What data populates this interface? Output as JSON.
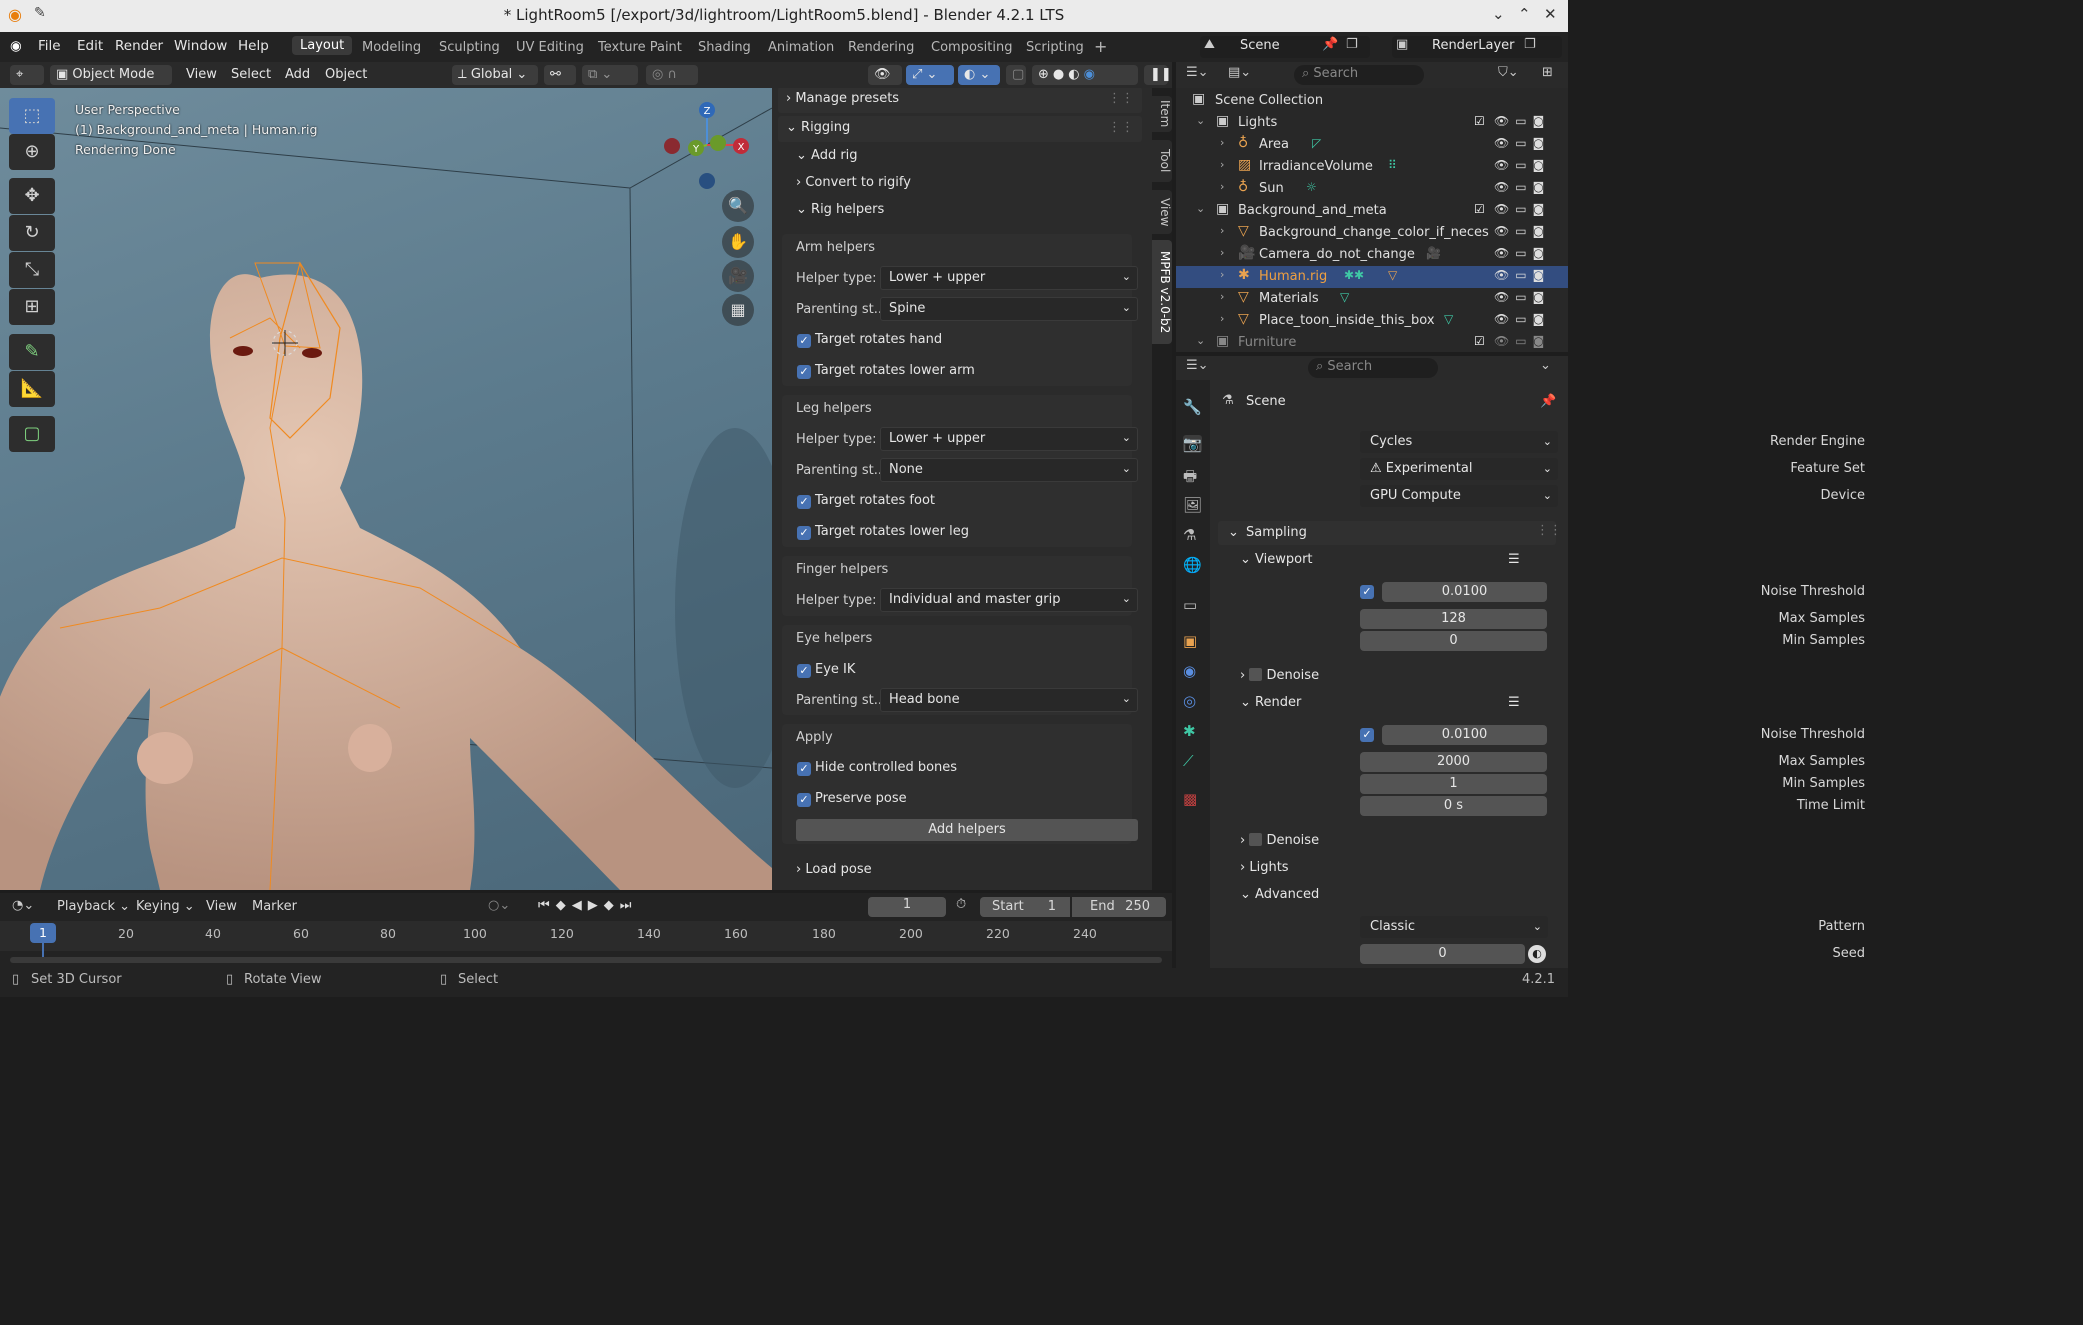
{
  "window": {
    "title": "* LightRoom5 [/export/3d/lightroom/LightRoom5.blend] - Blender 4.2.1 LTS"
  },
  "menu": {
    "file": "File",
    "edit": "Edit",
    "render": "Render",
    "window": "Window",
    "help": "Help"
  },
  "workspaces": [
    "Layout",
    "Modeling",
    "Sculpting",
    "UV Editing",
    "Texture Paint",
    "Shading",
    "Animation",
    "Rendering",
    "Compositing",
    "Scripting"
  ],
  "scene": {
    "name": "Scene",
    "view_layer": "RenderLayer"
  },
  "viewport_header": {
    "mode": "Object Mode",
    "view": "View",
    "select": "Select",
    "add": "Add",
    "object": "Object",
    "orientation": "Global"
  },
  "viewport": {
    "perspective": "User Perspective",
    "context": "(1) Background_and_meta | Human.rig",
    "status": "Rendering Done"
  },
  "gizmo": {
    "z": "Z",
    "y": "Y",
    "x": "X"
  },
  "npanel": {
    "manage_presets": "Manage presets",
    "rigging": "Rigging",
    "add_rig": "Add rig",
    "convert": "Convert to rigify",
    "rig_helpers": "Rig helpers",
    "arm": {
      "title": "Arm helpers",
      "helper_label": "Helper type:",
      "helper": "Lower + upper",
      "parent_label": "Parenting st...",
      "parent": "Spine",
      "c1": "Target rotates hand",
      "c2": "Target rotates lower arm"
    },
    "leg": {
      "title": "Leg helpers",
      "helper_label": "Helper type:",
      "helper": "Lower + upper",
      "parent_label": "Parenting st...",
      "parent": "None",
      "c1": "Target rotates foot",
      "c2": "Target rotates lower leg"
    },
    "finger": {
      "title": "Finger helpers",
      "helper_label": "Helper type:",
      "helper": "Individual and master grip"
    },
    "eye": {
      "title": "Eye helpers",
      "c1": "Eye IK",
      "parent_label": "Parenting st...",
      "parent": "Head bone"
    },
    "apply": {
      "title": "Apply",
      "c1": "Hide controlled bones",
      "c2": "Preserve pose",
      "button": "Add helpers"
    },
    "load_pose": "Load pose"
  },
  "sidebar_tabs": [
    "Item",
    "Tool",
    "View",
    "MPFB v2.0-b2"
  ],
  "outliner": {
    "search_placeholder": "Search",
    "root": "Scene Collection",
    "rows": [
      {
        "name": "Lights"
      },
      {
        "name": "Area"
      },
      {
        "name": "IrradianceVolume"
      },
      {
        "name": "Sun"
      },
      {
        "name": "Background_and_meta"
      },
      {
        "name": "Background_change_color_if_neces"
      },
      {
        "name": "Camera_do_not_change"
      },
      {
        "name": "Human.rig"
      },
      {
        "name": "Materials"
      },
      {
        "name": "Place_toon_inside_this_box"
      },
      {
        "name": "Furniture"
      }
    ]
  },
  "properties": {
    "search_placeholder": "Search",
    "context": "Scene",
    "render_engine_label": "Render Engine",
    "render_engine": "Cycles",
    "feature_set_label": "Feature Set",
    "feature_set": "Experimental",
    "device_label": "Device",
    "device": "GPU Compute",
    "sampling": "Sampling",
    "viewport": "Viewport",
    "vp_noise_label": "Noise Threshold",
    "vp_noise": "0.0100",
    "vp_max_label": "Max Samples",
    "vp_max": "128",
    "vp_min_label": "Min Samples",
    "vp_min": "0",
    "denoise": "Denoise",
    "render": "Render",
    "r_noise_label": "Noise Threshold",
    "r_noise": "0.0100",
    "r_max_label": "Max Samples",
    "r_max": "2000",
    "r_min_label": "Min Samples",
    "r_min": "1",
    "time_label": "Time Limit",
    "time": "0 s",
    "denoise2": "Denoise",
    "lights": "Lights",
    "advanced": "Advanced",
    "pattern_label": "Pattern",
    "pattern": "Classic",
    "seed_label": "Seed",
    "seed": "0"
  },
  "timeline": {
    "playback": "Playback",
    "keying": "Keying",
    "view": "View",
    "marker": "Marker",
    "current": "1",
    "start_label": "Start",
    "start": "1",
    "end_label": "End",
    "end": "250",
    "ticks": [
      "1",
      "20",
      "40",
      "60",
      "80",
      "100",
      "120",
      "140",
      "160",
      "180",
      "200",
      "220",
      "240"
    ]
  },
  "status": {
    "a": "Set 3D Cursor",
    "b": "Rotate View",
    "c": "Select",
    "version": "4.2.1"
  }
}
